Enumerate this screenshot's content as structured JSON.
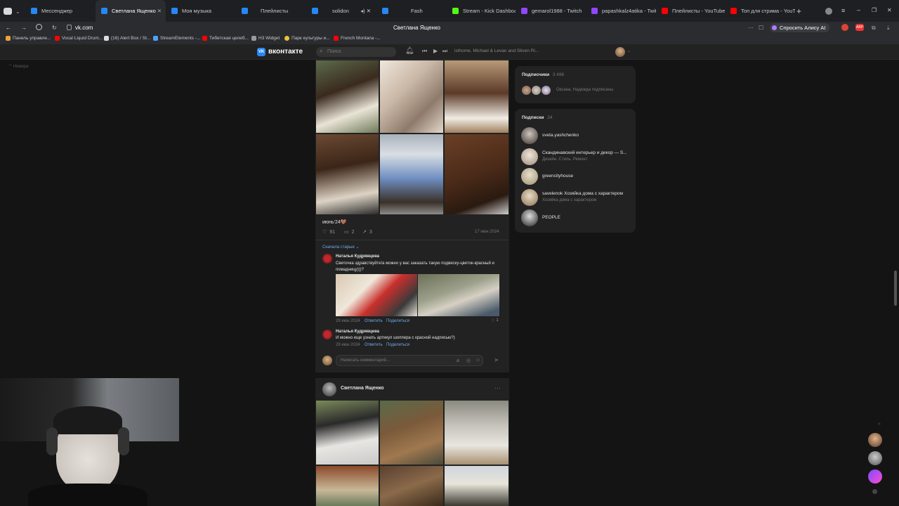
{
  "browser": {
    "tabs": [
      {
        "label": "Мессенджер",
        "color": "#2787f5"
      },
      {
        "label": "Светлана Ященко",
        "color": "#2787f5"
      },
      {
        "label": "Моя музыка",
        "color": "#2787f5"
      },
      {
        "label": "Плейлисты",
        "color": "#2787f5"
      },
      {
        "label": "solidon",
        "color": "#2787f5"
      },
      {
        "label": "Fash",
        "color": "#2787f5"
      },
      {
        "label": "Stream - Kick Dashboard",
        "color": "#53fc18"
      },
      {
        "label": "gemarol1988 - Twitch",
        "color": "#9146ff"
      },
      {
        "label": "papashkalz4atika - Twitch",
        "color": "#9146ff"
      },
      {
        "label": "Плейлисты - YouTube",
        "color": "#ff0000"
      },
      {
        "label": "Топ для стрима - YouTube",
        "color": "#ff0000"
      }
    ],
    "url": "vk.com",
    "page_title": "Светлана Ященко",
    "alice": "Спросить Алису AI",
    "bookmarks": [
      "Панель управле...",
      "Vocal Liquid Drum...",
      "(16) Alert Box / St...",
      "StreamElements -...",
      "Тибетская целеб...",
      "H3 Widget",
      "Парк культуры и...",
      "French Montana -..."
    ]
  },
  "vk": {
    "logo": "вконтакте",
    "search_placeholder": "Поиск",
    "player_track": "isthome, Michael & Levan and Stiven Ri...",
    "left_hint": "Номера"
  },
  "post": {
    "caption": "июнь'24🤎",
    "likes": "91",
    "comments": "2",
    "shares": "3",
    "date": "17 июн 2024",
    "sort_label": "Сначала старые ⌄",
    "comments_list": [
      {
        "author": "Наталья Кудрявцева",
        "text": "Светочка здравствуйте!а можно у вас заказать такую подвеску-цветок-красный и помадницу)))?",
        "date": "29 июн 2024",
        "reply": "Ответить",
        "share": "Поделиться",
        "likes": "1"
      },
      {
        "author": "Наталья Кудрявцева",
        "text": "И можно еще узнать артикул шоппера с красной надписью?)",
        "date": "29 июн 2024",
        "reply": "Ответить",
        "share": "Поделиться"
      }
    ],
    "comment_placeholder": "Написать комментарий...",
    "next_author": "Светлана Ященко"
  },
  "sidebar": {
    "followers_title": "Подписчики",
    "followers_count": "3 496",
    "followers_text": "Оксана, Надежда подписаны",
    "subs_title": "Подписки",
    "subs_count": "24",
    "subs": [
      {
        "name": "sveta.yashchenko",
        "sub": ""
      },
      {
        "name": "Скандинавский интерьер и декор — S...",
        "sub": "Дизайн. Стиль. Ремонт"
      },
      {
        "name": "greencityhouse",
        "sub": ""
      },
      {
        "name": "savelenok Хозяйка дома с характером",
        "sub": "Хозяйка дома с характером"
      },
      {
        "name": "PEOPLE",
        "sub": ""
      }
    ]
  },
  "colors": {
    "accent": "#71aaeb",
    "vk_blue": "#2787f5",
    "bg": "#141414",
    "card": "#222222"
  }
}
